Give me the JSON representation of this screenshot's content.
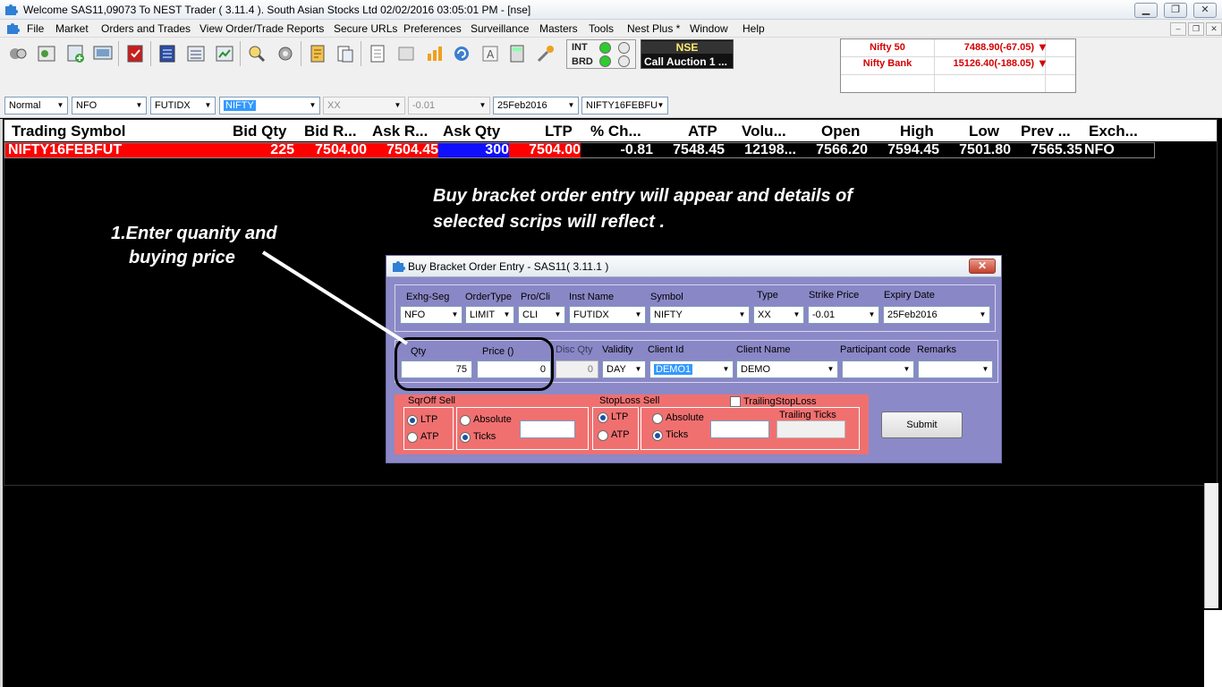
{
  "window": {
    "title": "Welcome SAS11,09073 To NEST Trader ( 3.11.4 ).  South Asian Stocks Ltd   02/02/2016  03:05:01 PM - [nse]",
    "minimize": "▁",
    "restore": "❐",
    "close": "✕"
  },
  "menu": {
    "items": [
      "File",
      "Market",
      "Orders and Trades",
      "View Order/Trade Reports",
      "Secure URLs",
      "Preferences",
      "Surveillance",
      "Masters",
      "Tools",
      "Nest Plus *",
      "Window",
      "Help"
    ],
    "sub_min": "–",
    "sub_restore": "❐",
    "sub_close": "✕"
  },
  "status": {
    "int_label": "INT",
    "brd_label": "BRD",
    "exchange": "NSE",
    "session": "Call Auction 1 ..."
  },
  "indices": [
    {
      "name": "Nifty 50",
      "value": "7488.90(-67.05)",
      "arrow": "▼"
    },
    {
      "name": "Nifty Bank",
      "value": "15126.40(-188.05)",
      "arrow": "▼"
    }
  ],
  "filters": {
    "order_type": "Normal",
    "exchange": "NFO",
    "instrument": "FUTIDX",
    "symbol": "NIFTY",
    "option_type": "XX",
    "strike": "-0.01",
    "expiry": "25Feb2016",
    "contract": "NIFTY16FEBFU",
    "dropdown_glyph": "▼"
  },
  "market_watch": {
    "columns": [
      "Trading Symbol",
      "Bid Qty",
      "Bid R...",
      "Ask R...",
      "Ask Qty",
      "LTP",
      "% Ch...",
      "ATP",
      "Volu...",
      "Open",
      "High",
      "Low",
      "Prev ...",
      "Exch..."
    ],
    "row": {
      "symbol": "NIFTY16FEBFUT",
      "bid_qty": "225",
      "bid_rate": "7504.00",
      "ask_rate": "7504.45",
      "ask_qty": "300",
      "ltp": "7504.00",
      "pct_change": "-0.81",
      "atp": "7548.45",
      "volume": "12198...",
      "open": "7566.20",
      "high": "7594.45",
      "low": "7501.80",
      "prev_close": "7565.35",
      "exchange": "NFO"
    }
  },
  "annotations": {
    "top_line1": "Buy bracket order entry will appear and details of",
    "top_line2": "selected scrips will reflect .",
    "left_line1": "1.Enter quanity and",
    "left_line2": "buying price"
  },
  "dialog": {
    "title": "Buy Bracket Order Entry - SAS11( 3.11.1 )",
    "close": "✕",
    "row1_labels": {
      "exhg_seg": "Exhg-Seg",
      "order_type": "OrderType",
      "pro_cli": "Pro/Cli",
      "inst_name": "Inst Name",
      "symbol": "Symbol",
      "type": "Type",
      "strike_price": "Strike Price",
      "expiry_date": "Expiry Date"
    },
    "row1_values": {
      "exhg_seg": "NFO",
      "order_type": "LIMIT",
      "pro_cli": "CLI",
      "inst_name": "FUTIDX",
      "symbol": "NIFTY",
      "type": "XX",
      "strike_price": "-0.01",
      "expiry_date": "25Feb2016"
    },
    "row2_labels": {
      "qty": "Qty",
      "price": "Price ()",
      "disc_qty": "Disc Qty",
      "validity": "Validity",
      "client_id": "Client Id",
      "client_name": "Client Name",
      "participant_code": "Participant code",
      "remarks": "Remarks"
    },
    "row2_values": {
      "qty": "75",
      "price": "0",
      "disc_qty": "0",
      "validity": "DAY",
      "client_id": "DEMO1",
      "client_name": "DEMO",
      "participant_code": "",
      "remarks": ""
    },
    "sqroff": {
      "title": "SqrOff Sell",
      "ltp": "LTP",
      "atp": "ATP",
      "absolute": "Absolute",
      "ticks": "Ticks",
      "value": ""
    },
    "stoploss": {
      "title": "StopLoss Sell",
      "ltp": "LTP",
      "atp": "ATP",
      "absolute": "Absolute",
      "ticks": "Ticks",
      "value": ""
    },
    "trailing": {
      "checkbox_label": "TrailingStopLoss",
      "ticks_label": "Trailing Ticks",
      "value": ""
    },
    "submit": "Submit"
  },
  "colors": {
    "bid_red": "#ff0000",
    "ask_blue": "#1010ff",
    "panel_purple": "#8a87c6",
    "panel_red": "#f07070",
    "index_red": "#d40000"
  }
}
